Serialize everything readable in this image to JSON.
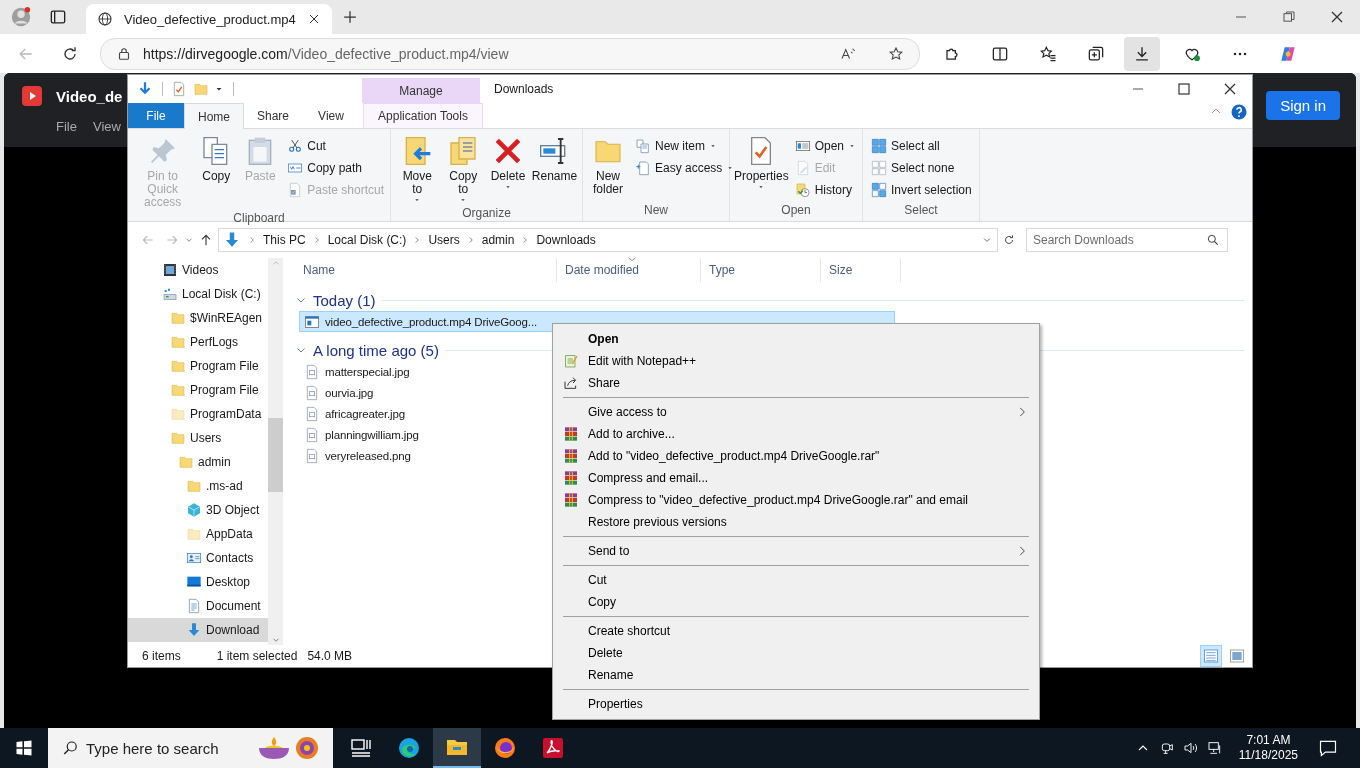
{
  "browser": {
    "tab_title": "Video_defective_product.mp4",
    "url_host": "https://dirvegoogle.com",
    "url_path": "/Video_defective_product.mp4/view"
  },
  "page": {
    "title": "Video_de",
    "menu": [
      "File",
      "View"
    ],
    "sign_in": "Sign in"
  },
  "explorer": {
    "title": "Downloads",
    "context_group": "Manage",
    "tabs": [
      {
        "label": "File",
        "kind": "file",
        "selected": false
      },
      {
        "label": "Home",
        "kind": "tab",
        "selected": true
      },
      {
        "label": "Share",
        "kind": "tab",
        "selected": false
      },
      {
        "label": "View",
        "kind": "tab",
        "selected": false
      },
      {
        "label": "Application Tools",
        "kind": "context",
        "selected": false
      }
    ],
    "ribbon": [
      {
        "label": "Clipboard",
        "large": [
          {
            "label": "Pin to Quick access",
            "disabled": true,
            "menu": false
          },
          {
            "label": "Copy",
            "disabled": false,
            "menu": false
          },
          {
            "label": "Paste",
            "disabled": true,
            "menu": false
          }
        ],
        "small": [
          {
            "label": "Cut",
            "disabled": false,
            "menu": false
          },
          {
            "label": "Copy path",
            "disabled": false,
            "menu": false
          },
          {
            "label": "Paste shortcut",
            "disabled": true,
            "menu": false
          }
        ]
      },
      {
        "label": "Organize",
        "large": [
          {
            "label": "Move to",
            "disabled": false,
            "menu": true
          },
          {
            "label": "Copy to",
            "disabled": false,
            "menu": true
          },
          {
            "label": "Delete",
            "disabled": false,
            "menu": true
          },
          {
            "label": "Rename",
            "disabled": false,
            "menu": false
          }
        ]
      },
      {
        "label": "New",
        "large": [
          {
            "label": "New folder",
            "disabled": false,
            "menu": false
          }
        ],
        "small": [
          {
            "label": "New item",
            "disabled": false,
            "menu": true
          },
          {
            "label": "Easy access",
            "disabled": false,
            "menu": true
          }
        ]
      },
      {
        "label": "Open",
        "large": [
          {
            "label": "Properties",
            "disabled": false,
            "menu": true
          }
        ],
        "small": [
          {
            "label": "Open",
            "disabled": false,
            "menu": true
          },
          {
            "label": "Edit",
            "disabled": true,
            "menu": false
          },
          {
            "label": "History",
            "disabled": false,
            "menu": false
          }
        ]
      },
      {
        "label": "Select",
        "small": [
          {
            "label": "Select all",
            "disabled": false,
            "menu": false
          },
          {
            "label": "Select none",
            "disabled": false,
            "menu": false
          },
          {
            "label": "Invert selection",
            "disabled": false,
            "menu": false
          }
        ]
      }
    ],
    "breadcrumb": [
      "This PC",
      "Local Disk (C:)",
      "Users",
      "admin",
      "Downloads"
    ],
    "search": {
      "placeholder": "Search Downloads"
    },
    "nav": [
      {
        "label": "Videos",
        "selected": false
      },
      {
        "label": "Local Disk (C:)",
        "selected": false,
        "children": [
          {
            "label": "$WinREAgen",
            "selected": false
          },
          {
            "label": "PerfLogs",
            "selected": false
          },
          {
            "label": "Program File",
            "selected": false
          },
          {
            "label": "Program File",
            "selected": false
          },
          {
            "label": "ProgramData",
            "selected": false
          },
          {
            "label": "Users",
            "selected": false,
            "children": [
              {
                "label": "admin",
                "selected": false,
                "children": [
                  {
                    "label": ".ms-ad",
                    "selected": false
                  },
                  {
                    "label": "3D Object",
                    "selected": false
                  },
                  {
                    "label": "AppData",
                    "selected": false
                  },
                  {
                    "label": "Contacts",
                    "selected": false
                  },
                  {
                    "label": "Desktop",
                    "selected": false
                  },
                  {
                    "label": "Document",
                    "selected": false
                  },
                  {
                    "label": "Download",
                    "selected": true
                  }
                ]
              }
            ]
          }
        ]
      }
    ],
    "columns": [
      "Name",
      "Date modified",
      "Type",
      "Size"
    ],
    "groups": [
      {
        "label": "Today (1)",
        "files": [
          {
            "name": "video_defective_product.mp4 DriveGoog...",
            "kind": "app",
            "selected": true
          }
        ]
      },
      {
        "label": "A long time ago (5)",
        "files": [
          {
            "name": "matterspecial.jpg",
            "kind": "file",
            "selected": false
          },
          {
            "name": "ourvia.jpg",
            "kind": "file",
            "selected": false
          },
          {
            "name": "africagreater.jpg",
            "kind": "file",
            "selected": false
          },
          {
            "name": "planningwilliam.jpg",
            "kind": "file",
            "selected": false
          },
          {
            "name": "veryreleased.png",
            "kind": "file",
            "selected": false
          }
        ]
      }
    ],
    "status": {
      "count": "6 items",
      "selection": "1 item selected",
      "size": "54.0 MB"
    },
    "view_modes": [
      {
        "selected": true
      },
      {
        "selected": false
      }
    ]
  },
  "context_menu": [
    {
      "kind": "item",
      "label": "Open",
      "bold": true,
      "submenu": false
    },
    {
      "kind": "item",
      "label": "Edit with Notepad++",
      "bold": false,
      "submenu": false
    },
    {
      "kind": "item",
      "label": "Share",
      "bold": false,
      "submenu": false
    },
    {
      "kind": "separator"
    },
    {
      "kind": "item",
      "label": "Give access to",
      "bold": false,
      "submenu": true
    },
    {
      "kind": "item",
      "label": "Add to archive...",
      "bold": false,
      "submenu": false
    },
    {
      "kind": "item",
      "label": "Add to \"video_defective_product.mp4 DriveGoogle.rar\"",
      "bold": false,
      "submenu": false
    },
    {
      "kind": "item",
      "label": "Compress and email...",
      "bold": false,
      "submenu": false
    },
    {
      "kind": "item",
      "label": "Compress to \"video_defective_product.mp4 DriveGoogle.rar\" and email",
      "bold": false,
      "submenu": false
    },
    {
      "kind": "item",
      "label": "Restore previous versions",
      "bold": false,
      "submenu": false
    },
    {
      "kind": "separator"
    },
    {
      "kind": "item",
      "label": "Send to",
      "bold": false,
      "submenu": true
    },
    {
      "kind": "separator"
    },
    {
      "kind": "item",
      "label": "Cut",
      "bold": false,
      "submenu": false
    },
    {
      "kind": "item",
      "label": "Copy",
      "bold": false,
      "submenu": false
    },
    {
      "kind": "separator"
    },
    {
      "kind": "item",
      "label": "Create shortcut",
      "bold": false,
      "submenu": false
    },
    {
      "kind": "item",
      "label": "Delete",
      "bold": false,
      "submenu": false
    },
    {
      "kind": "item",
      "label": "Rename",
      "bold": false,
      "submenu": false
    },
    {
      "kind": "separator"
    },
    {
      "kind": "item",
      "label": "Properties",
      "bold": false,
      "submenu": false
    }
  ],
  "taskbar": {
    "search_placeholder": "Type here to search",
    "apps": [
      {
        "active": false
      },
      {
        "active": false
      },
      {
        "active": true
      },
      {
        "active": false
      },
      {
        "active": false
      }
    ],
    "time": "7:01 AM",
    "date": "11/18/2025"
  }
}
